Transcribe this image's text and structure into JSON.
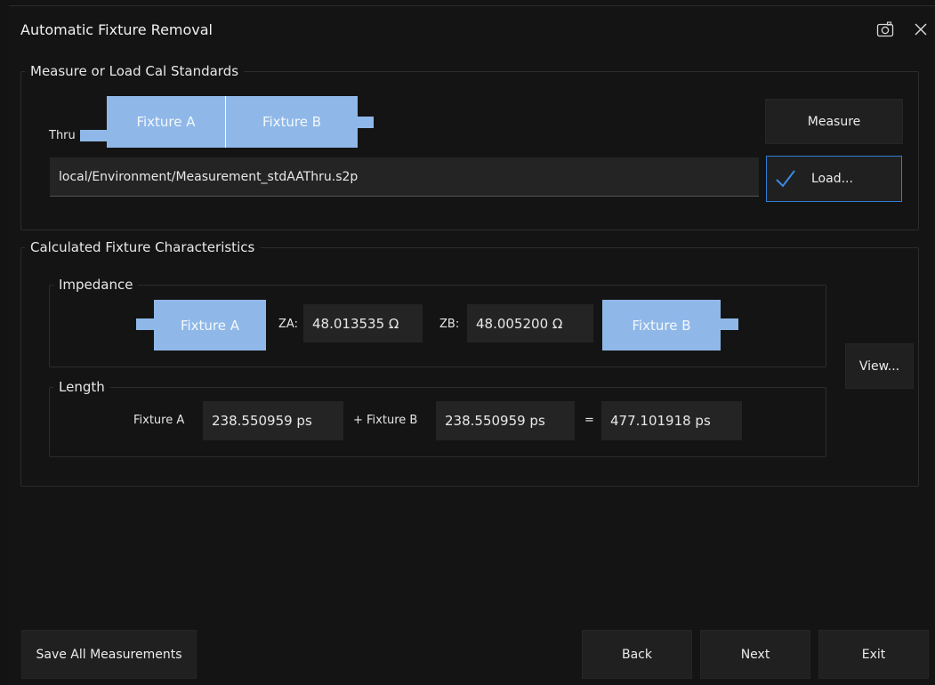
{
  "window": {
    "title": "Automatic Fixture Removal"
  },
  "measure_group": {
    "legend": "Measure or Load Cal Standards",
    "thru_label": "Thru",
    "fixture_a": "Fixture A",
    "fixture_b": "Fixture B",
    "measure_button": "Measure",
    "file_path": "local/Environment/Measurement_stdAAThru.s2p",
    "load_button": "Load...",
    "load_checked": true
  },
  "calc_group": {
    "legend": "Calculated Fixture Characteristics",
    "impedance": {
      "legend": "Impedance",
      "fixture_a": "Fixture A",
      "fixture_b": "Fixture B",
      "za_label": "ZA:",
      "za_value": "48.013535 Ω",
      "zb_label": "ZB:",
      "zb_value": "48.005200 Ω"
    },
    "length": {
      "legend": "Length",
      "fixture_a_label": "Fixture A",
      "fixture_a_value": "238.550959 ps",
      "plus_label": "+ Fixture B",
      "fixture_b_value": "238.550959 ps",
      "equals": "=",
      "total_value": "477.101918 ps"
    },
    "view_button": "View..."
  },
  "footer": {
    "save_all": "Save All Measurements",
    "back": "Back",
    "next": "Next",
    "exit": "Exit"
  },
  "colors": {
    "background": "#141414",
    "fixture_blue": "#8fb8e8",
    "accent_blue": "#2f7fd6"
  }
}
